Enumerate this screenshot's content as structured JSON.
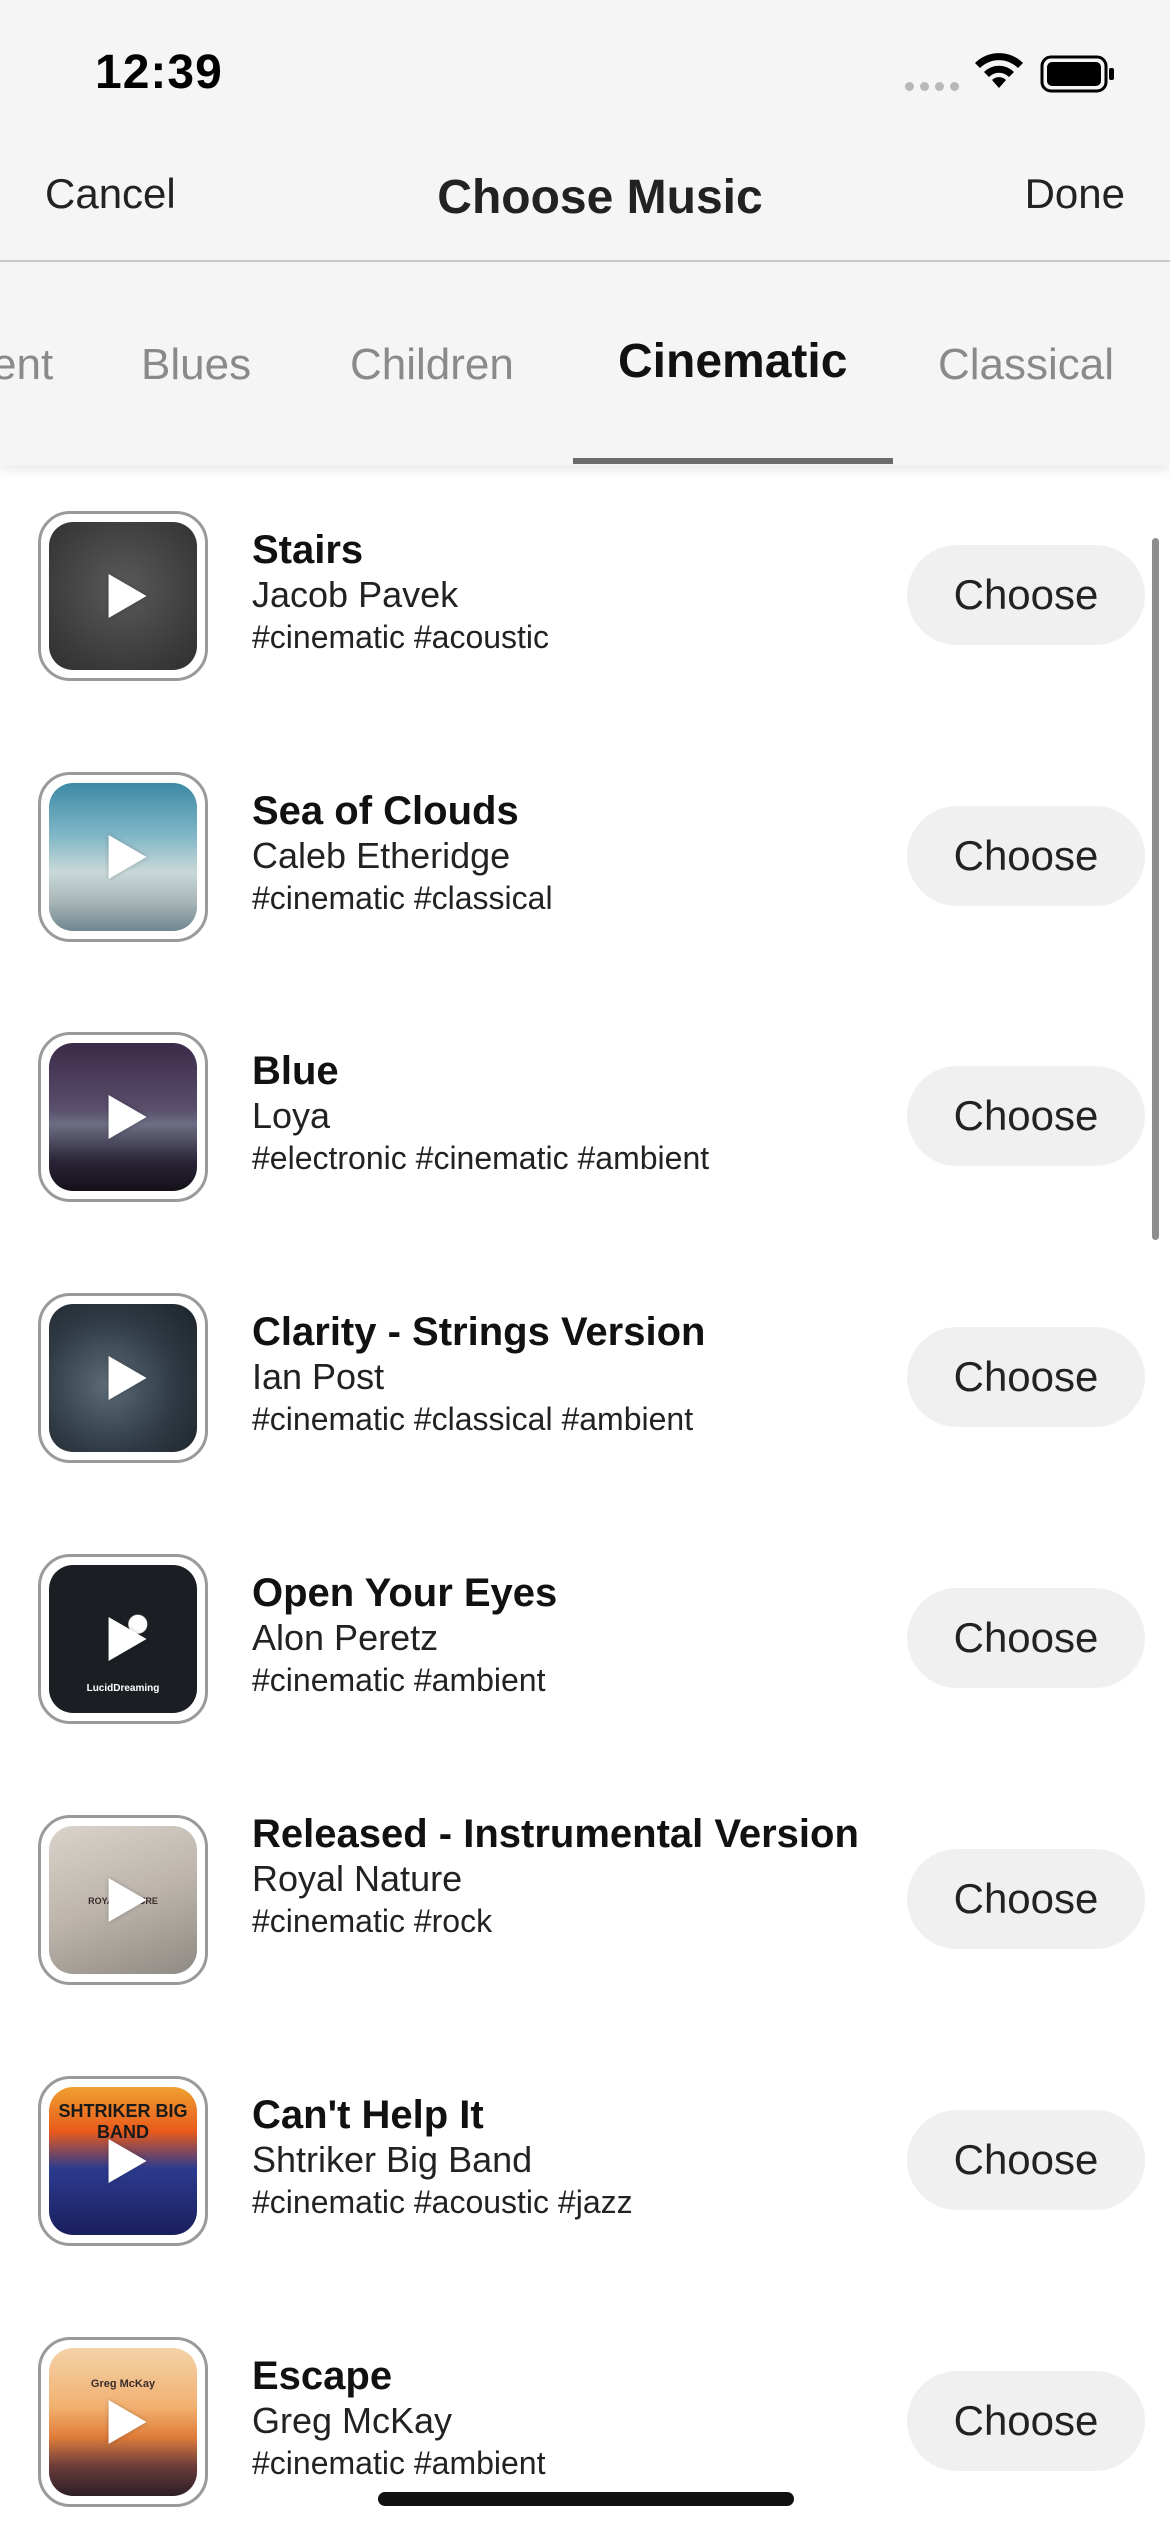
{
  "status_bar": {
    "time": "12:39",
    "icons": [
      "cellular-signal-icon",
      "wifi-icon",
      "battery-icon"
    ]
  },
  "nav": {
    "cancel_label": "Cancel",
    "title": "Choose Music",
    "done_label": "Done"
  },
  "tabs": [
    {
      "label": "ent",
      "active": false
    },
    {
      "label": "Blues",
      "active": false
    },
    {
      "label": "Children",
      "active": false
    },
    {
      "label": "Cinematic",
      "active": true
    },
    {
      "label": "Classical",
      "active": false
    }
  ],
  "tracks": [
    {
      "title": "Stairs",
      "artist": "Jacob Pavek",
      "tags": "#cinematic #acoustic",
      "button": "Choose"
    },
    {
      "title": "Sea of Clouds",
      "artist": "Caleb Etheridge",
      "tags": "#cinematic #classical",
      "button": "Choose"
    },
    {
      "title": "Blue",
      "artist": "Loya",
      "tags": "#electronic #cinematic #ambient",
      "button": "Choose"
    },
    {
      "title": "Clarity - Strings Version",
      "artist": "Ian Post",
      "tags": "#cinematic #classical #ambient",
      "button": "Choose"
    },
    {
      "title": "Open Your Eyes",
      "artist": "Alon Peretz",
      "tags": "#cinematic #ambient",
      "button": "Choose",
      "art_text": "LucidDreaming"
    },
    {
      "title": "Released - Instrumental Version",
      "artist": "Royal Nature",
      "tags": "#cinematic #rock",
      "button": "Choose",
      "art_text": "ROYAL NATURE"
    },
    {
      "title": "Can't Help It",
      "artist": "Shtriker Big Band",
      "tags": "#cinematic #acoustic #jazz",
      "button": "Choose",
      "art_text": "SHTRIKER BIG BAND"
    },
    {
      "title": "Escape",
      "artist": "Greg McKay",
      "tags": "#cinematic #ambient",
      "button": "Choose",
      "art_text": "Greg McKay"
    }
  ],
  "colors": {
    "header_bg": "#f5f5f5",
    "button_bg": "#f0f0f0",
    "active_tab": "#111111",
    "inactive_tab": "#8a8a8a"
  }
}
